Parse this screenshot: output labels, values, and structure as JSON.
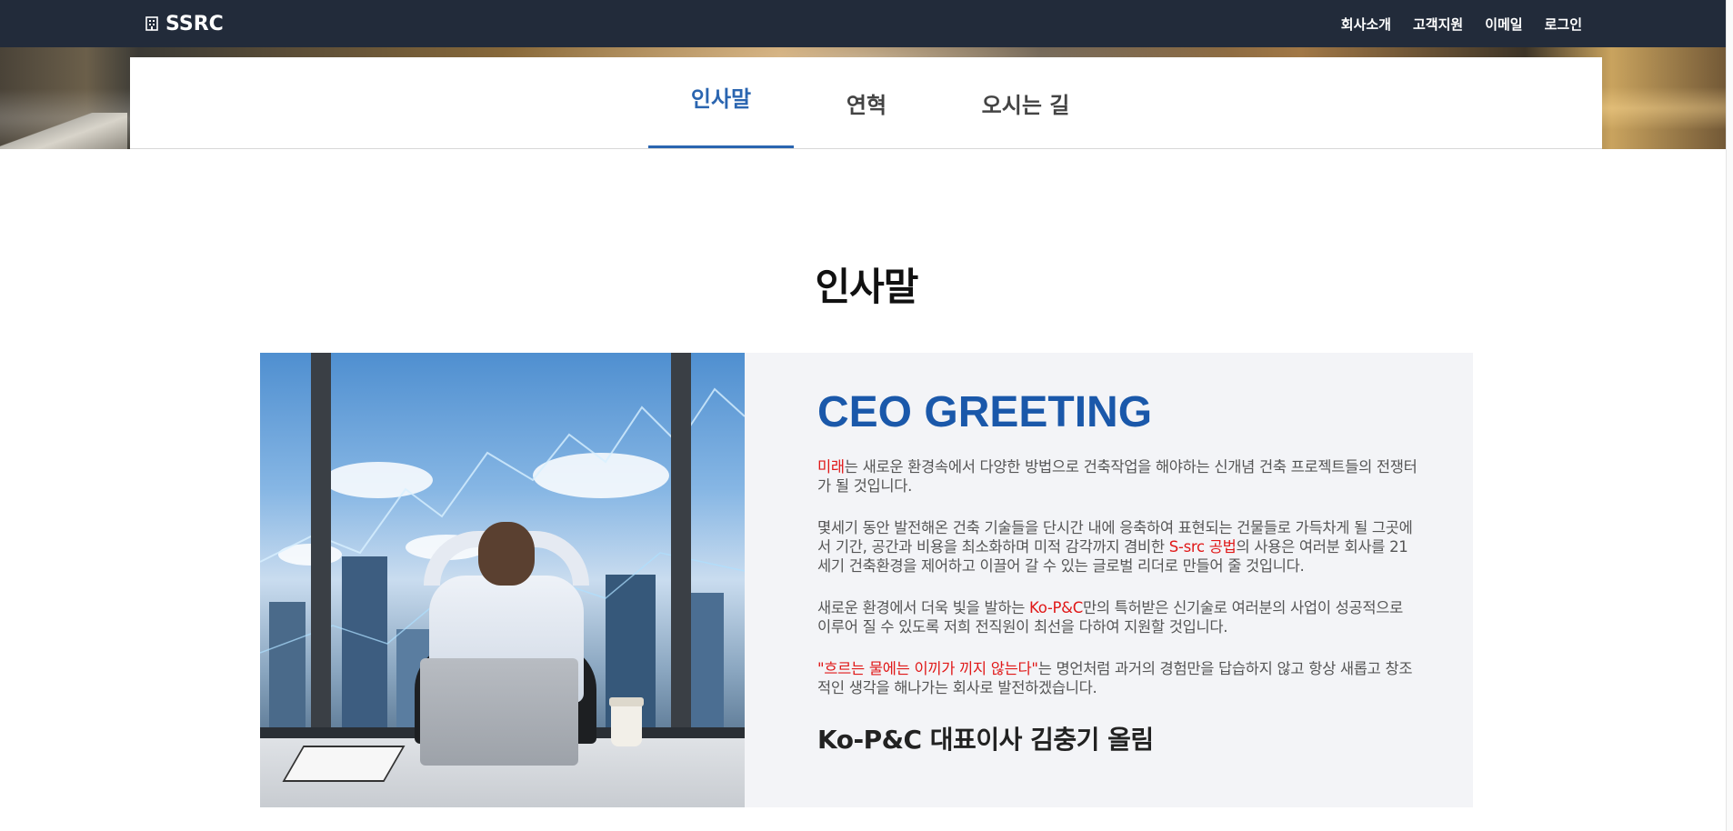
{
  "navbar": {
    "brand": "SSRC",
    "links": [
      "회사소개",
      "고객지원",
      "이메일",
      "로그인"
    ]
  },
  "subtabs": [
    {
      "label": "인사말",
      "active": true
    },
    {
      "label": "연혁",
      "active": false
    },
    {
      "label": "오시는 길",
      "active": false
    }
  ],
  "page_title": "인사말",
  "greeting": {
    "heading": "CEO GREETING",
    "p1": {
      "hl": "미래",
      "rest": "는 새로운 환경속에서 다양한 방법으로 건축작업을 해야하는 신개념 건축 프로젝트들의 전쟁터가 될 것입니다."
    },
    "p2": {
      "pre": "몇세기 동안 발전해온 건축 기술들을 단시간 내에 응축하여 표현되는 건물들로 가득차게 될 그곳에서 기간, 공간과 비용을 최소화하며 미적 감각까지 겸비한 ",
      "hl": "S-src 공법",
      "post": "의 사용은 여러분 회사를 21세기 건축환경을 제어하고 이끌어 갈 수 있는 글로벌 리더로 만들어 줄 것입니다."
    },
    "p3": {
      "pre": "새로운 환경에서 더욱 빛을 발하는 ",
      "hl": "Ko-P&C",
      "post": "만의 특허받은 신기술로 여러분의 사업이 성공적으로 이루어 질 수 있도록 저희 전직원이 최선을 다하여 지원할 것입니다."
    },
    "p4": {
      "hl": "\"흐르는 물에는 이끼가 끼지 않는다\"",
      "post": "는 명언처럼 과거의 경험만을 답습하지 않고 항상 새롭고 창조적인 생각을 해나가는 회사로 발전하겠습니다."
    },
    "signature": "Ko-P&C 대표이사 김충기 올림"
  },
  "colors": {
    "navbar_bg": "#222b3a",
    "accent": "#2a65b0",
    "heading_blue": "#1a58aa",
    "highlight_red": "#e01818"
  }
}
